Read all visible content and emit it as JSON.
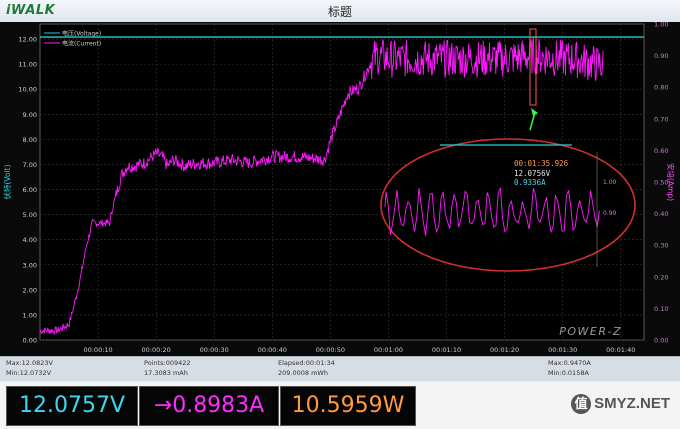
{
  "window": {
    "brand": "iWALK",
    "title": "标题"
  },
  "chart_data": {
    "type": "line",
    "title": "标题",
    "ylabel_left": "伏特(Volt)",
    "ylabel_right": "安培(Amp)",
    "left_axis_ticks": [
      "0.00",
      "1.00",
      "2.00",
      "3.00",
      "4.00",
      "5.00",
      "6.00",
      "7.00",
      "8.00",
      "9.00",
      "10.00",
      "11.00",
      "12.00"
    ],
    "right_axis_ticks": [
      "0.00",
      "0.10",
      "0.20",
      "0.30",
      "0.40",
      "0.50",
      "0.60",
      "0.70",
      "0.80",
      "0.90",
      "1.00"
    ],
    "x_ticks": [
      "00:00:10",
      "00:00:20",
      "00:00:30",
      "00:00:40",
      "00:00:50",
      "00:01:00",
      "00:01:10",
      "00:01:20",
      "00:01:30",
      "00:01:40"
    ],
    "ylim_left": [
      0,
      12.6
    ],
    "ylim_right": [
      0,
      1.0
    ],
    "xlim_seconds": [
      0,
      104
    ],
    "grid": true,
    "legend_position": "top-left",
    "series": [
      {
        "name": "电压(Voltage)",
        "color": "#22cfd6",
        "axis": "left",
        "x_seconds": [
          0,
          104
        ],
        "values": [
          12.08,
          12.08
        ]
      },
      {
        "name": "电流(Current)",
        "color": "#ff19ff",
        "axis": "right",
        "x_seconds": [
          0,
          3,
          5,
          6,
          7,
          8,
          9,
          11,
          12,
          12.5,
          14,
          15,
          16,
          18,
          20,
          21,
          22,
          23,
          25,
          27,
          30,
          33,
          36,
          40,
          45,
          49,
          50,
          51,
          52,
          53,
          55,
          56,
          57,
          58,
          60,
          70,
          80,
          85,
          90,
          92,
          94,
          97
        ],
        "values": [
          0.03,
          0.03,
          0.05,
          0.12,
          0.2,
          0.3,
          0.37,
          0.37,
          0.37,
          0.42,
          0.52,
          0.55,
          0.55,
          0.56,
          0.59,
          0.58,
          0.55,
          0.57,
          0.55,
          0.56,
          0.56,
          0.57,
          0.56,
          0.58,
          0.58,
          0.57,
          0.63,
          0.68,
          0.73,
          0.78,
          0.8,
          0.84,
          0.88,
          0.9,
          0.89,
          0.89,
          0.89,
          0.9,
          0.89,
          0.89,
          0.88,
          0.87
        ]
      }
    ],
    "inset": {
      "time": "00:01:35.926",
      "voltage": "12.0756V",
      "current": "0.9336A",
      "ticks": [
        "1.00",
        "0.90"
      ]
    }
  },
  "brand_watermark": "POWER-Z",
  "status": {
    "max_v": "Max:12.0823V",
    "min_v": "Min:12.0732V",
    "points": "Points:009422",
    "mah": "17.3083 mAh",
    "elapsed": "Elapsed:00:01:34",
    "mwh": "209.0008 mWh",
    "max_a": "Max:0.9470A",
    "min_a": "Min:0.0158A"
  },
  "readouts": {
    "voltage": "12.0757V",
    "current": "→0.8983A",
    "power": "10.5959W",
    "voltage_color": "#3fd7f0",
    "current_color": "#ff2bff",
    "power_color": "#ff9a40"
  },
  "watermark": {
    "icon": "值",
    "text": "SMYZ.NET"
  }
}
